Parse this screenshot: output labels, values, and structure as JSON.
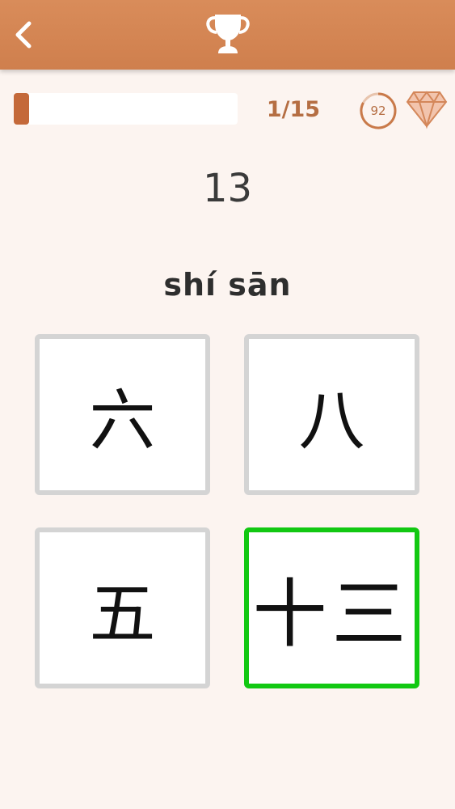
{
  "header": {
    "back_icon": "chevron-left-icon",
    "trophy_icon": "trophy-icon"
  },
  "status": {
    "progress": 0.067,
    "counter": "1/15",
    "timer": "92",
    "timer_icon": "circular-timer-icon",
    "gem_icon": "diamond-icon"
  },
  "question": {
    "number": "13",
    "pinyin": "shí sān"
  },
  "options": [
    {
      "label": "六",
      "state": "default"
    },
    {
      "label": "八",
      "state": "default"
    },
    {
      "label": "五",
      "state": "default"
    },
    {
      "label": "十三",
      "state": "correct"
    }
  ],
  "colors": {
    "header": "#d4875a",
    "accent": "#c4693a",
    "correct_border": "#12c812",
    "default_border": "#d4d4d4",
    "background": "#fcf4f0"
  }
}
